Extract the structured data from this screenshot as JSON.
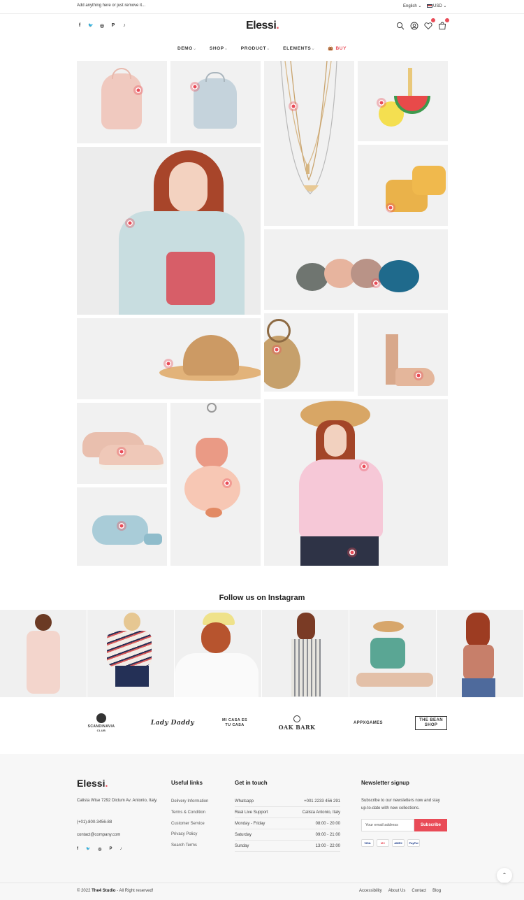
{
  "topbar": {
    "message": "Add anything here or just remove it...",
    "language": "English ⌄",
    "currency": "USD ⌄"
  },
  "header": {
    "logo": "Elessi",
    "logo_dot": ".",
    "social_icons": [
      "facebook-icon",
      "twitter-icon",
      "instagram-icon",
      "pinterest-icon",
      "tiktok-icon"
    ],
    "social_glyphs": [
      "f",
      "🐦",
      "◎",
      "P",
      "♪"
    ]
  },
  "nav": {
    "items": [
      {
        "label": "DEMO",
        "chev": "⌄"
      },
      {
        "label": "SHOP",
        "chev": "⌄"
      },
      {
        "label": "PRODUCT",
        "chev": "⌄"
      },
      {
        "label": "ELEMENTS",
        "chev": "⌄"
      }
    ],
    "buy": "BUY"
  },
  "colors": {
    "accent": "#e94b57"
  },
  "instagram": {
    "title": "Follow us on Instagram"
  },
  "brands": [
    {
      "name": "SCANDINAVIA",
      "sub": "CLUB"
    },
    {
      "name": "Lady Daddy",
      "sub": ""
    },
    {
      "name": "MI CASA ES TU CASA",
      "sub": ""
    },
    {
      "name": "OAK BARK",
      "sub": ""
    },
    {
      "name": "APPXGAMES",
      "sub": ""
    },
    {
      "name": "THE BEAN SHOP",
      "sub": ""
    }
  ],
  "footer": {
    "logo": "Elessi",
    "address": "Calista Wise 7292 Dictum Av. Antonio, Italy.",
    "phone": "(+01)-800-3456-88",
    "email": "contact@company.com",
    "useful_links": {
      "heading": "Useful links",
      "items": [
        "Delivery Information",
        "Terms & Condition",
        "Customer Service",
        "Privacy Policy",
        "Search Terms"
      ]
    },
    "get_in_touch": {
      "heading": "Get in touch",
      "rows": [
        {
          "label": "Whatsapp",
          "value": "+001 2233 456 291"
        },
        {
          "label": "Real Live Support",
          "value": "Calista Antonio, Italy"
        },
        {
          "label": "Monday - Friday",
          "value": "08:00 - 20:00"
        },
        {
          "label": "Saturday",
          "value": "09:00 - 21:00"
        },
        {
          "label": "Sunday",
          "value": "13:00 - 22:00"
        }
      ]
    },
    "newsletter": {
      "heading": "Newsletter signup",
      "text": "Subscribe to our newsletters now and stay up-to-date with new collections.",
      "placeholder": "Your email address",
      "button": "Subscribe",
      "payments": [
        "VISA",
        "MC",
        "AMEX",
        "PayPal"
      ]
    },
    "copyright_year": "© 2022",
    "copyright_brand": "The4 Studio",
    "copyright_rest": " - All Right reserved!",
    "bottom_links": [
      "Accessibility",
      "About Us",
      "Contact",
      "Blog"
    ],
    "to_top": "⌃"
  }
}
